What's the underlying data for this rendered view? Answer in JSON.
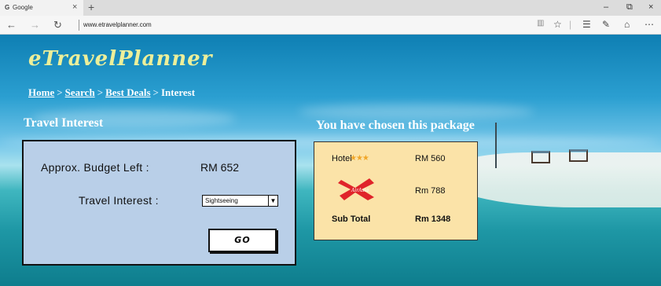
{
  "browser": {
    "tab_icon": "G",
    "tab_title": "Google",
    "tab_close": "×",
    "new_tab": "+",
    "url": "www.etravelplanner.com",
    "nav_back": "←",
    "nav_forward": "→",
    "nav_refresh": "↻",
    "win_min": "–",
    "win_max": "⧉",
    "win_close": "×"
  },
  "site": {
    "logo": "eTravelPlanner"
  },
  "breadcrumb": {
    "home": "Home",
    "search": "Search",
    "best_deals": "Best Deals",
    "current": "Interest",
    "separator": ">"
  },
  "travel_interest": {
    "heading": "Travel Interest",
    "budget_label": "Approx. Budget Left :",
    "budget_value": "RM 652",
    "interest_label": "Travel Interest :",
    "interest_selected": "Sightseeing",
    "go_label": "GO"
  },
  "package": {
    "heading": "You have chosen this package",
    "hotel_label": "Hotel",
    "hotel_stars": "★★★",
    "hotel_price": "RM 560",
    "airline_logo_text": "AirAsia",
    "airline_price": "Rm 788",
    "subtotal_label": "Sub Total",
    "subtotal_value": "Rm 1348"
  },
  "colors": {
    "logo": "#ecef9a",
    "panel_bg": "#b9cfe8",
    "package_bg": "#fbe3a8",
    "airline_red": "#e0242a"
  },
  "icons": [
    "back-arrow-icon",
    "forward-arrow-icon",
    "refresh-icon",
    "reading-view-icon",
    "favorite-star-icon",
    "hub-icon",
    "web-note-icon",
    "share-icon",
    "more-icon",
    "star-rating-icon",
    "airasia-logo"
  ]
}
